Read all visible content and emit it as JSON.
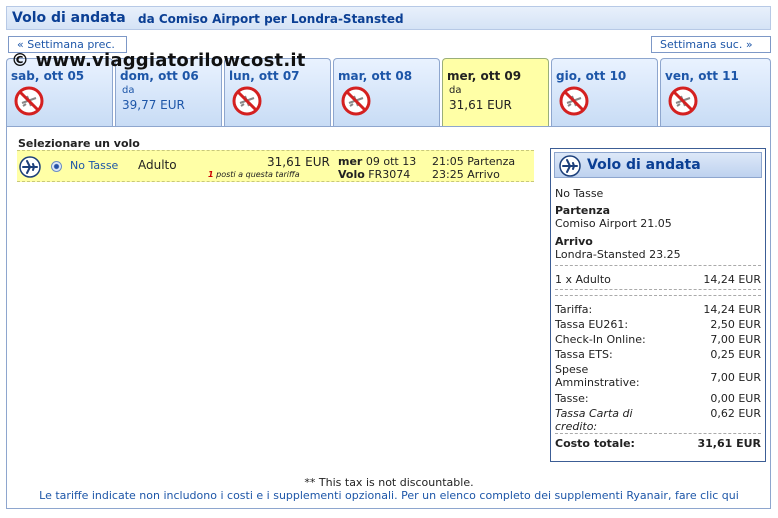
{
  "header": {
    "title": "Volo di andata",
    "route": "da Comiso Airport per Londra-Stansted"
  },
  "nav": {
    "prev": "« Settimana prec.",
    "next": "Settimana suc. »"
  },
  "watermark": "© www.viaggiatorilowcost.it",
  "days": [
    {
      "name": "sab, ott 05",
      "available": false
    },
    {
      "name": "dom, ott 06",
      "available": true,
      "from": "da",
      "price": "39,77 EUR"
    },
    {
      "name": "lun, ott 07",
      "available": false
    },
    {
      "name": "mar, ott 08",
      "available": false
    },
    {
      "name": "mer, ott 09",
      "available": true,
      "selected": true,
      "from": "da",
      "price": "31,61 EUR"
    },
    {
      "name": "gio, ott 10",
      "available": false
    },
    {
      "name": "ven, ott 11",
      "available": false
    }
  ],
  "select_title": "Selezionare un volo",
  "flight": {
    "fare": "No Tasse",
    "passenger": "Adulto",
    "price": "31,61 EUR",
    "seats_num": "1",
    "seats_text": "posti a questa tariffa",
    "day_label": "mer",
    "date": "09 ott 13",
    "flight_label": "Volo",
    "flight_no": "FR3074",
    "departure": "21:05 Partenza",
    "arrival": "23:25 Arrivo"
  },
  "summary": {
    "title": "Volo di andata",
    "fare": "No Tasse",
    "dep_label": "Partenza",
    "dep_value": "Comiso Airport 21.05",
    "arr_label": "Arrivo",
    "arr_value": "Londra-Stansted 23.25",
    "pax": "1 x Adulto",
    "pax_value": "14,24 EUR",
    "rows": [
      {
        "label": "Tariffa:",
        "value": "14,24 EUR"
      },
      {
        "label": "Tassa EU261:",
        "value": "2,50 EUR"
      },
      {
        "label": "Check-In Online:",
        "value": "7,00 EUR"
      },
      {
        "label": "Tassa ETS:",
        "value": "0,25 EUR"
      },
      {
        "label": "Spese Amminstrative:",
        "value": "7,00 EUR"
      },
      {
        "label": "Tasse:",
        "value": "0,00 EUR"
      },
      {
        "label": "Tassa Carta di credito:",
        "value": "0,62 EUR"
      }
    ],
    "total_label": "Costo totale:",
    "total_value": "31,61 EUR"
  },
  "footer": {
    "note": "** This tax is not discountable.",
    "info": "Le tariffe indicate non includono i costi e i supplementi opzionali. Per un elenco completo dei supplementi Ryanair, fare clic qui"
  }
}
